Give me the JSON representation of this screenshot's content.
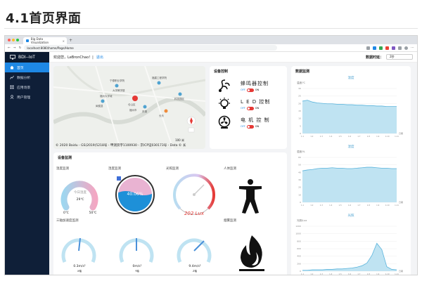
{
  "doc": {
    "title": "4.1首页界面"
  },
  "browser": {
    "tab_title": "Big Data Visualization",
    "tab_close": "×",
    "new_tab": "+",
    "address": "localhost:8080/home/Page/Home"
  },
  "sidebar": {
    "brand": "BDI--IoT",
    "items": [
      {
        "label": "首页",
        "icon": "home-icon"
      },
      {
        "label": "数据分析",
        "icon": "chart-icon"
      },
      {
        "label": "应用场景",
        "icon": "grid-icon"
      },
      {
        "label": "用户管理",
        "icon": "user-icon"
      }
    ]
  },
  "topbar": {
    "welcome": "欢迎您，LeBronChao！|",
    "logout": "退出",
    "refresh_label": "数据时延：",
    "refresh_value": "2秒"
  },
  "map": {
    "caption": "© 2020 Baidu - GS(2019)5218号 - 甲测资字1100930 - 京ICP证030173号 - Data © 长",
    "scale": "100 米",
    "places": [
      "宁德职业学院",
      "福建工程学院",
      "大学教学楼",
      "仓山区",
      "福州市",
      "闽侯县",
      "科技园区",
      "长乐",
      "东湖",
      "福州大学城"
    ]
  },
  "control": {
    "title": "设备控制",
    "devices": [
      {
        "name": "蜂鸣器控制",
        "off": "OFF",
        "on": "ON",
        "icon": "buzzer-icon"
      },
      {
        "name": "L E D 控制",
        "off": "OFF",
        "on": "ON",
        "icon": "bulb-icon"
      },
      {
        "name": "电 机 控 制",
        "off": "OFF",
        "on": "ON",
        "icon": "fan-icon"
      }
    ]
  },
  "monitor": {
    "title": "设备监测",
    "temperature": {
      "label": "温度监测",
      "center": "今日温度",
      "value": "29℃",
      "min": "0℃",
      "max": "50℃"
    },
    "humidity": {
      "label": "湿度监测",
      "value": "40.06%"
    },
    "light": {
      "label": "光照监测",
      "value": "202 Lux"
    },
    "body": {
      "label": "人体监测"
    },
    "accel": {
      "label": "三轴加速度监测",
      "axes": [
        {
          "value": "0.3m/s²",
          "axis": "X轴"
        },
        {
          "value": "0m/s²",
          "axis": "Y轴"
        },
        {
          "value": "9.4m/s²",
          "axis": "Z轴"
        }
      ]
    },
    "smoke": {
      "label": "烟雾监测"
    }
  },
  "data_panel": {
    "title": "数据监测",
    "charts": [
      {
        "title": "温度",
        "unit": "温度/℃",
        "yticks": [
          "30",
          "25",
          "20",
          "15",
          "10",
          "5",
          "0"
        ]
      },
      {
        "title": "湿度",
        "unit": "湿度/%",
        "yticks": [
          "60",
          "50",
          "40",
          "30",
          "20",
          "10",
          "0"
        ]
      },
      {
        "title": "光照",
        "unit": "光照/Lux",
        "yticks": [
          "1200",
          "1000",
          "800",
          "600",
          "400",
          "200",
          "0"
        ]
      }
    ],
    "xlabel": "日期",
    "xticks": [
      "1.1",
      "1.2",
      "1.3",
      "1.4",
      "1.5",
      "1.6",
      "1.7",
      "1.8",
      "1.9",
      "1.10",
      "1.11"
    ]
  },
  "colors": {
    "sidebar": "#0f1f38",
    "accent": "#1e88e5",
    "chart_fill": "#bfe3f2",
    "chart_line": "#5ab4dc",
    "light_value": "#e53935"
  }
}
